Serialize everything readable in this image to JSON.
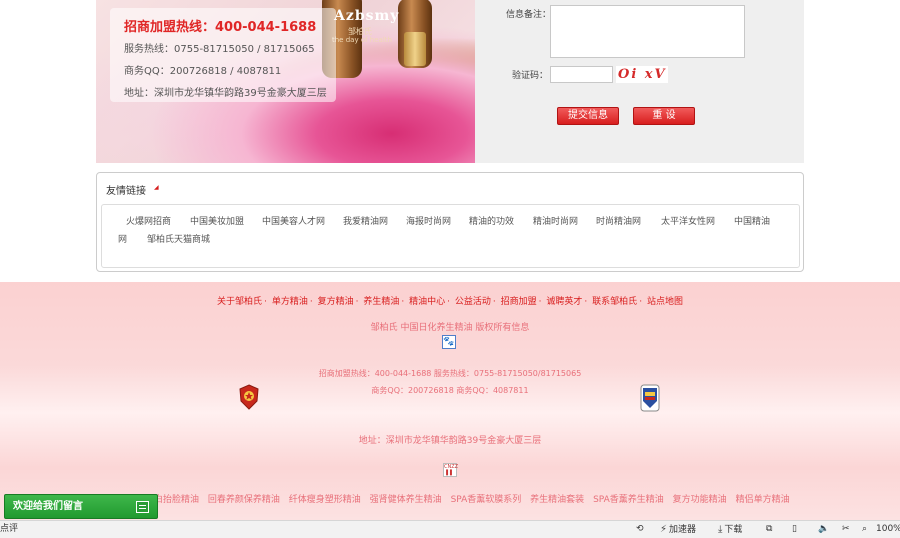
{
  "banner": {
    "hotline": "招商加盟热线：400-044-1688",
    "service": "服务热线：0755-81715050 / 81715065",
    "qq": "商务QQ：200726818 / 4087811",
    "address": "地址：深圳市龙华镇华韵路39号金豪大厦三层",
    "brand_name": "Azbsmy",
    "brand_sub": "邹柏氏",
    "brand_tag": "the day of health"
  },
  "form": {
    "note_label": "信息备注：",
    "captcha_label": "验证码：",
    "captcha_text": "Oi xV",
    "submit_label": "提交信息",
    "reset_label": "重 设"
  },
  "links": {
    "title": "友情链接",
    "items": [
      "火爆网招商",
      "中国美妆加盟",
      "中国美容人才网",
      "我爱精油网",
      "海报时尚网",
      "精油的功效",
      "精油时尚网",
      "时尚精油网",
      "太平洋女性网",
      "中国精油",
      "网",
      "邹柏氏天猫商城"
    ]
  },
  "footer": {
    "nav": [
      "关于邹柏氏",
      "单方精油",
      "复方精油",
      "养生精油",
      "精油中心",
      "公益活动",
      "招商加盟",
      "诚聘英才",
      "联系邹柏氏",
      "站点地图"
    ],
    "copyright": "邹柏氏  中国日化养生精油  版权所有信息",
    "contact1": "招商加盟热线：400-044-1688    服务热线：0755-81715050/81715065",
    "contact2": "商务QQ：200726818    商务QQ：4087811",
    "address": "地址：深圳市龙华镇华韵路39号金豪大厦三层",
    "products": [
      "经美白抬脸精油",
      "回春养颜保养精油",
      "纤体瘦身塑形精油",
      "强肾健体养生精油",
      "SPA香薰软膜系列",
      "养生精油套装",
      "SPA香薰养生精油",
      "复方功能精油",
      "精侣单方精油"
    ]
  },
  "message_tab": "欢迎给我们留言",
  "statusbar": {
    "left": "点评",
    "accelerator": "加速器",
    "download": "下载",
    "zoom": "100%"
  },
  "colors": {
    "accent_red": "#d81e1e",
    "footer_pink": "#fbd6d6",
    "message_green": "#2ea43b"
  }
}
